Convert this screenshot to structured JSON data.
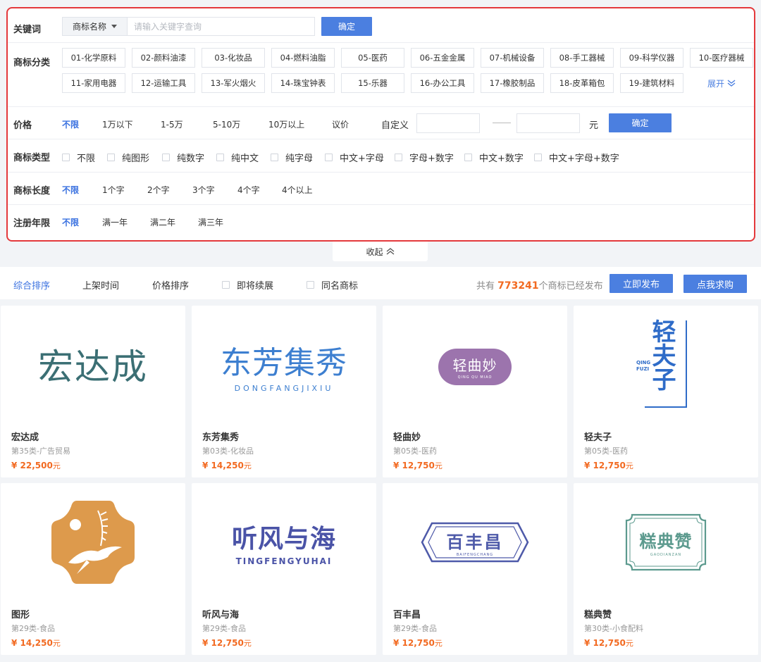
{
  "filters": {
    "keyword": {
      "label": "关键词",
      "select": "商标名称",
      "placeholder": "请输入关键字查询",
      "confirm": "确定"
    },
    "category": {
      "label": "商标分类",
      "items": [
        "01-化学原料",
        "02-颜料油漆",
        "03-化妆品",
        "04-燃料油脂",
        "05-医药",
        "06-五金金属",
        "07-机械设备",
        "08-手工器械",
        "09-科学仪器",
        "10-医疗器械",
        "11-家用电器",
        "12-运输工具",
        "13-军火烟火",
        "14-珠宝钟表",
        "15-乐器",
        "16-办公工具",
        "17-橡胶制品",
        "18-皮革箱包",
        "19-建筑材料"
      ],
      "expand": "展开"
    },
    "price": {
      "label": "价格",
      "options": [
        "不限",
        "1万以下",
        "1-5万",
        "5-10万",
        "10万以上",
        "议价"
      ],
      "custom": "自定义",
      "unit": "元",
      "confirm": "确定"
    },
    "type": {
      "label": "商标类型",
      "options": [
        "不限",
        "纯图形",
        "纯数字",
        "纯中文",
        "纯字母",
        "中文+字母",
        "字母+数字",
        "中文+数字",
        "中文+字母+数字"
      ]
    },
    "length": {
      "label": "商标长度",
      "options": [
        "不限",
        "1个字",
        "2个字",
        "3个字",
        "4个字",
        "4个以上"
      ]
    },
    "years": {
      "label": "注册年限",
      "options": [
        "不限",
        "满一年",
        "满二年",
        "满三年"
      ]
    },
    "collapse": "收起"
  },
  "sort": {
    "items": [
      "综合排序",
      "上架时间",
      "价格排序"
    ],
    "checks": [
      "即将续展",
      "同名商标"
    ],
    "total_prefix": "共有",
    "total": "773241",
    "total_suffix": "个商标已经发布",
    "publish": "立即发布",
    "buy": "点我求购"
  },
  "cards": [
    {
      "name": "宏达成",
      "cls": "第35类-广告贸易",
      "price": "¥ 22,500",
      "logo_text": "宏达成"
    },
    {
      "name": "东芳集秀",
      "cls": "第03类-化妆品",
      "price": "¥ 14,250",
      "logo_text": "东芳集秀",
      "logo_sub": "DONGFANGJIXIU"
    },
    {
      "name": "轻曲妙",
      "cls": "第05类-医药",
      "price": "¥ 12,750",
      "logo_text": "轻曲妙",
      "logo_sub": "QING QU MIAO"
    },
    {
      "name": "轻夫子",
      "cls": "第05类-医药",
      "price": "¥ 12,750",
      "logo_text": "轻夫子",
      "logo_sub": "QING FUZI"
    },
    {
      "name": "图形",
      "cls": "第29类-食品",
      "price": "¥ 14,250"
    },
    {
      "name": "听风与海",
      "cls": "第29类-食品",
      "price": "¥ 12,750",
      "logo_text": "听风与海",
      "logo_sub": "TINGFENGYUHAI"
    },
    {
      "name": "百丰昌",
      "cls": "第29类-食品",
      "price": "¥ 12,750",
      "logo_text": "百丰昌",
      "logo_sub": "BAIFENGCHANG"
    },
    {
      "name": "糕典赞",
      "cls": "第30类-小食配料",
      "price": "¥ 12,750",
      "logo_text": "糕典赞",
      "logo_sub": "GAODIANZAN"
    }
  ],
  "price_unit": "元",
  "colors": {
    "accent": "#4b7fe0",
    "price": "#f26a21",
    "highlight_border": "#e4393c"
  }
}
